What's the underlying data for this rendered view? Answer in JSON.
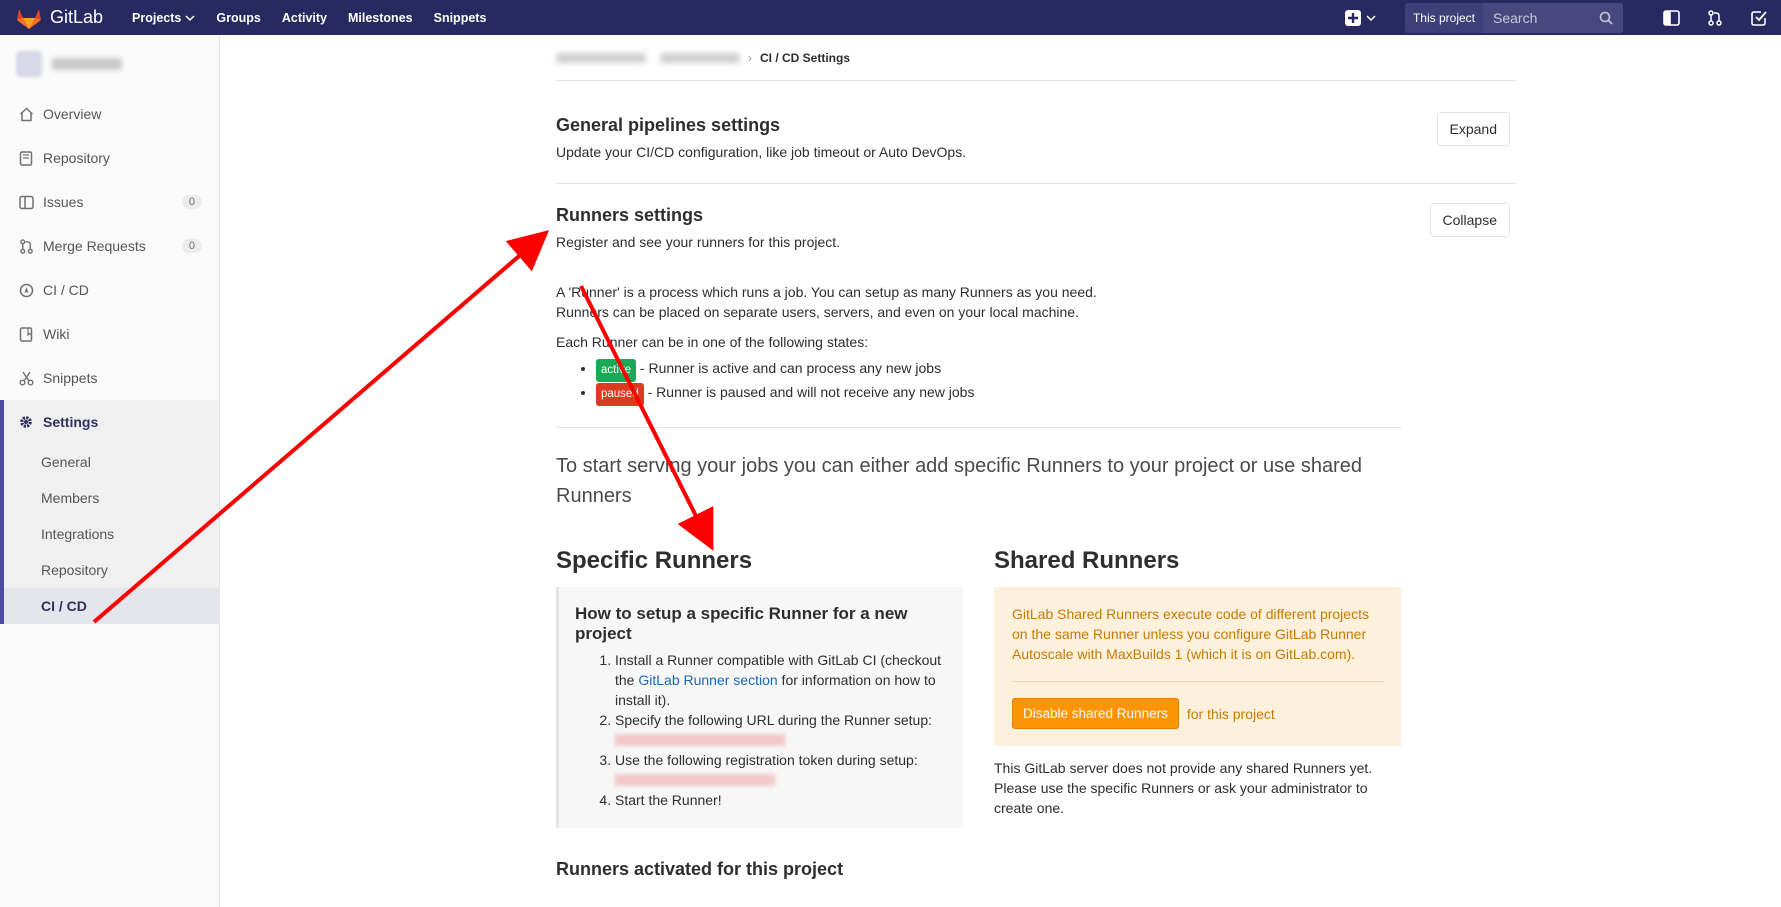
{
  "navbar": {
    "brand": "GitLab",
    "links": [
      "Projects",
      "Groups",
      "Activity",
      "Milestones",
      "Snippets"
    ],
    "search_scope": "This project",
    "search_placeholder": "Search"
  },
  "sidebar": {
    "items": [
      {
        "label": "Overview",
        "icon": "home-icon"
      },
      {
        "label": "Repository",
        "icon": "repository-icon"
      },
      {
        "label": "Issues",
        "icon": "issues-icon",
        "count": "0"
      },
      {
        "label": "Merge Requests",
        "icon": "merge-request-icon",
        "count": "0"
      },
      {
        "label": "CI / CD",
        "icon": "rocket-icon"
      },
      {
        "label": "Wiki",
        "icon": "book-icon"
      },
      {
        "label": "Snippets",
        "icon": "scissors-icon"
      }
    ],
    "settings_label": "Settings",
    "settings_sub": [
      "General",
      "Members",
      "Integrations",
      "Repository",
      "CI / CD"
    ]
  },
  "breadcrumb": {
    "current": "CI / CD Settings"
  },
  "general_pipelines": {
    "title": "General pipelines settings",
    "description": "Update your CI/CD configuration, like job timeout or Auto DevOps.",
    "button": "Expand"
  },
  "runners": {
    "title": "Runners settings",
    "description": "Register and see your runners for this project.",
    "button": "Collapse",
    "intro_line1": "A 'Runner' is a process which runs a job. You can setup as many Runners as you need.",
    "intro_line2": "Runners can be placed on separate users, servers, and even on your local machine.",
    "states_intro": "Each Runner can be in one of the following states:",
    "state_active_badge": "active",
    "state_active_text": " - Runner is active and can process any new jobs",
    "state_paused_badge": "paused",
    "state_paused_text": " - Runner is paused and will not receive any new jobs",
    "start_text": "To start serving your jobs you can either add specific Runners to your project or use shared Runners"
  },
  "specific": {
    "heading": "Specific Runners",
    "setup_title": "How to setup a specific Runner for a new project",
    "step1_a": "Install a Runner compatible with GitLab CI (checkout the ",
    "step1_link": "GitLab Runner section",
    "step1_b": " for information on how to install it).",
    "step2": "Specify the following URL during the Runner setup:",
    "step3": "Use the following registration token during setup:",
    "step4": "Start the Runner!"
  },
  "shared": {
    "heading": "Shared Runners",
    "warning": "GitLab Shared Runners execute code of different projects on the same Runner unless you configure GitLab Runner Autoscale with MaxBuilds 1 (which it is on GitLab.com).",
    "disable_button": "Disable shared Runners",
    "disable_suffix": "for this project",
    "note": "This GitLab server does not provide any shared Runners yet. Please use the specific Runners or ask your administrator to create one."
  },
  "activated_heading": "Runners activated for this project",
  "colors": {
    "navbar": "#292961",
    "annotation_arrow": "#ff0000",
    "active_badge": "#1aaa55",
    "paused_badge": "#db3b21",
    "warning_bg": "#fdf1dd",
    "warning_button": "#fc9403"
  }
}
